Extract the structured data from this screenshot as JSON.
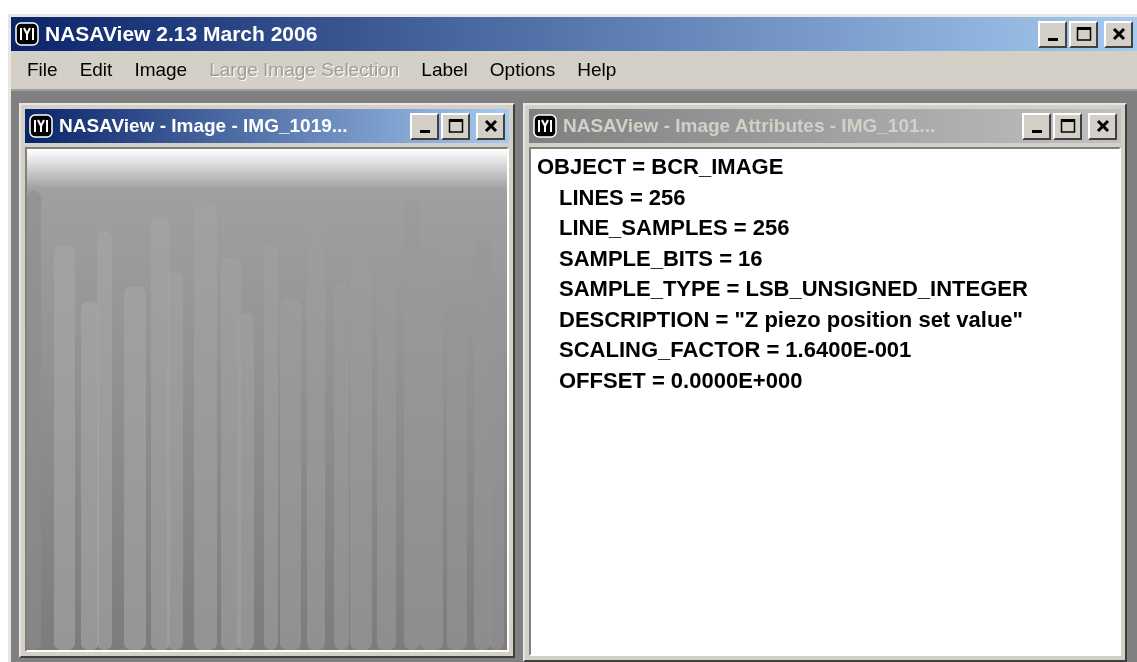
{
  "window": {
    "title": "NASAView 2.13 March 2006"
  },
  "menu": [
    {
      "label": "File",
      "disabled": false
    },
    {
      "label": "Edit",
      "disabled": false
    },
    {
      "label": "Image",
      "disabled": false
    },
    {
      "label": "Large Image Selection",
      "disabled": true
    },
    {
      "label": "Label",
      "disabled": false
    },
    {
      "label": "Options",
      "disabled": false
    },
    {
      "label": "Help",
      "disabled": false
    }
  ],
  "child_windows": [
    {
      "kind": "image",
      "title": "NASAView - Image - IMG_1019...",
      "active": true
    },
    {
      "kind": "attributes",
      "title": "NASAView - Image Attributes - IMG_101...",
      "active": false,
      "attributes": [
        {
          "text": "OBJECT = BCR_IMAGE",
          "children": [
            {
              "text": "LINES = 256"
            },
            {
              "text": "LINE_SAMPLES = 256"
            },
            {
              "text": "SAMPLE_BITS = 16"
            },
            {
              "text": "SAMPLE_TYPE = LSB_UNSIGNED_INTEGER"
            },
            {
              "text": "DESCRIPTION = \"Z piezo position set value\""
            },
            {
              "text": "SCALING_FACTOR = 1.6400E-001"
            },
            {
              "text": "OFFSET = 0.0000E+000"
            }
          ]
        }
      ]
    }
  ]
}
